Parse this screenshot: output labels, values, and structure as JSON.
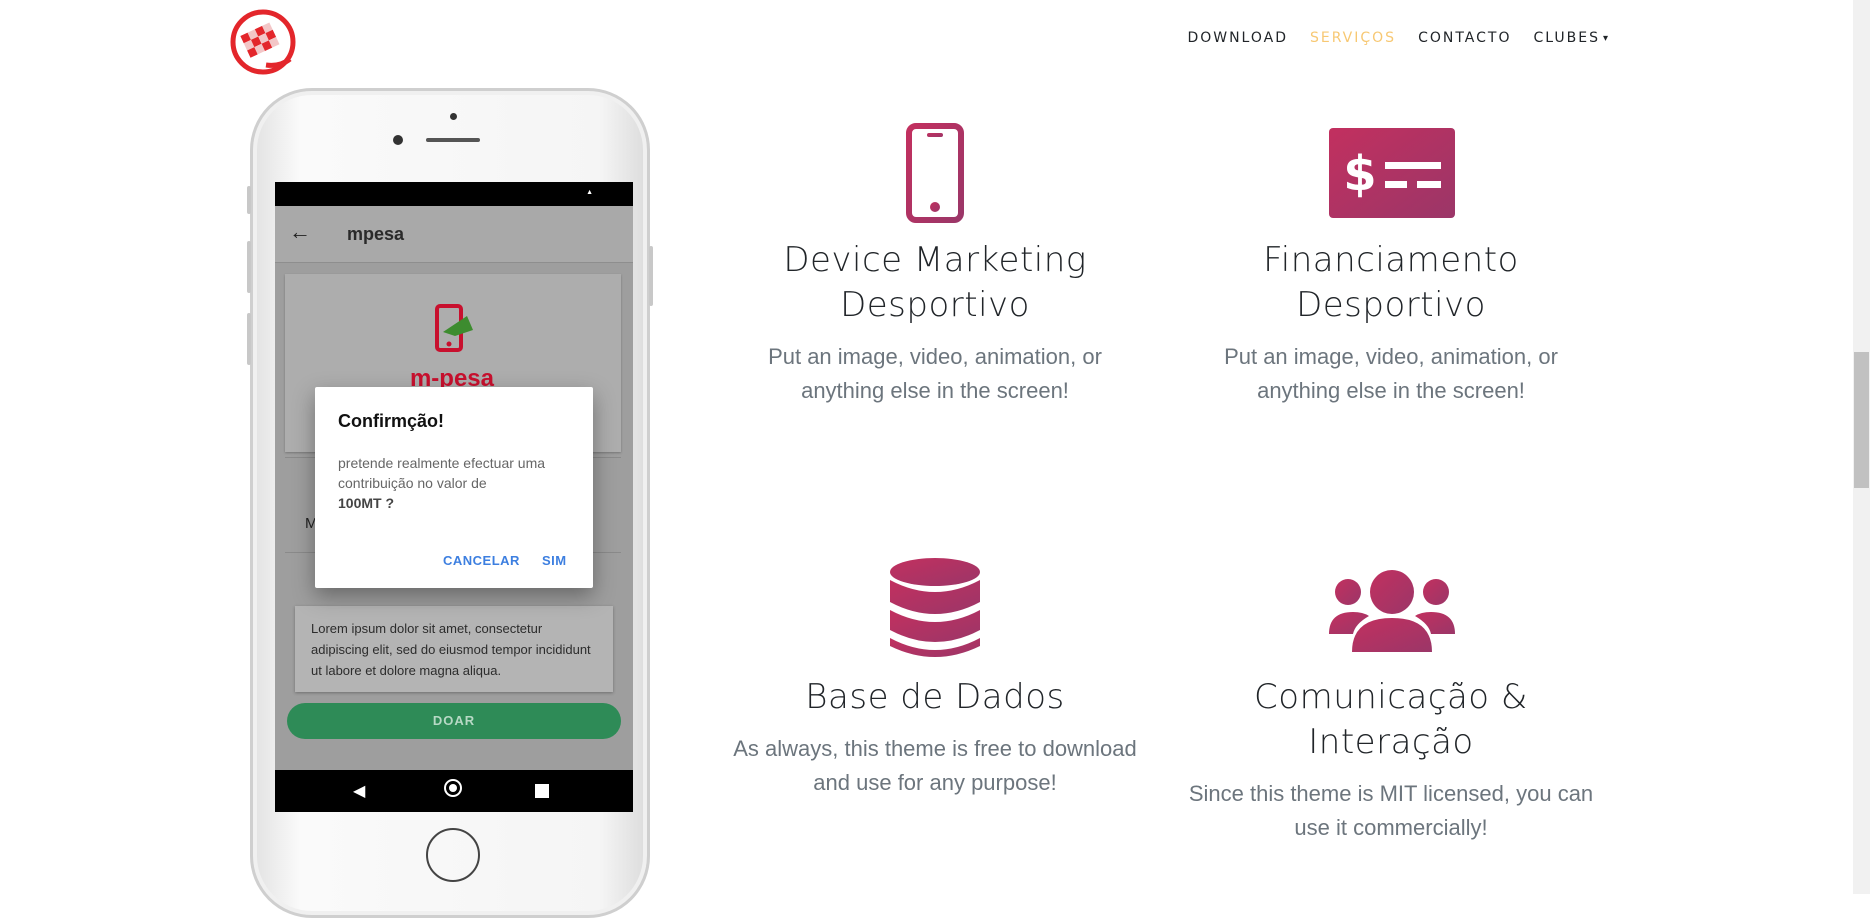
{
  "nav": {
    "items": [
      {
        "label": "DOWNLOAD",
        "active": false
      },
      {
        "label": "SERVIÇOS",
        "active": true
      },
      {
        "label": "CONTACTO",
        "active": false
      },
      {
        "label": "CLUBES",
        "active": false,
        "dropdown": true
      }
    ],
    "active_color": "#f7c873"
  },
  "phone": {
    "app_title": "mpesa",
    "logo_text": "m-pesa",
    "field_initial": "M",
    "description": "Lorem ipsum dolor sit amet, consectetur adipiscing elit, sed do eiusmod tempor incididunt ut labore et dolore magna aliqua.",
    "donate_label": "DOAR",
    "dialog": {
      "title": "Confirmção!",
      "body": "pretende realmente efectuar uma contribuição no valor de",
      "amount": "100MT ?",
      "cancel_label": "CANCELAR",
      "ok_label": "SIM"
    }
  },
  "features": [
    {
      "icon": "mobile-phone-icon",
      "title": "Device Marketing Desportivo",
      "desc": "Put an image, video, animation, or anything else in the screen!"
    },
    {
      "icon": "money-check-icon",
      "title": "Financiamento Desportivo",
      "desc": "Put an image, video, animation, or anything else in the screen!"
    },
    {
      "icon": "database-icon",
      "title": "Base de Dados",
      "desc": "As always, this theme is free to download and use for any purpose!"
    },
    {
      "icon": "users-icon",
      "title": "Comunicação & Interação",
      "desc": "Since this theme is MIT licensed, you can use it commercially!"
    }
  ],
  "colors": {
    "icon_gradient_start": "#c2305f",
    "icon_gradient_end": "#9b3668",
    "donate_green": "#2e8b57",
    "dialog_button_blue": "#3d7fe0"
  }
}
